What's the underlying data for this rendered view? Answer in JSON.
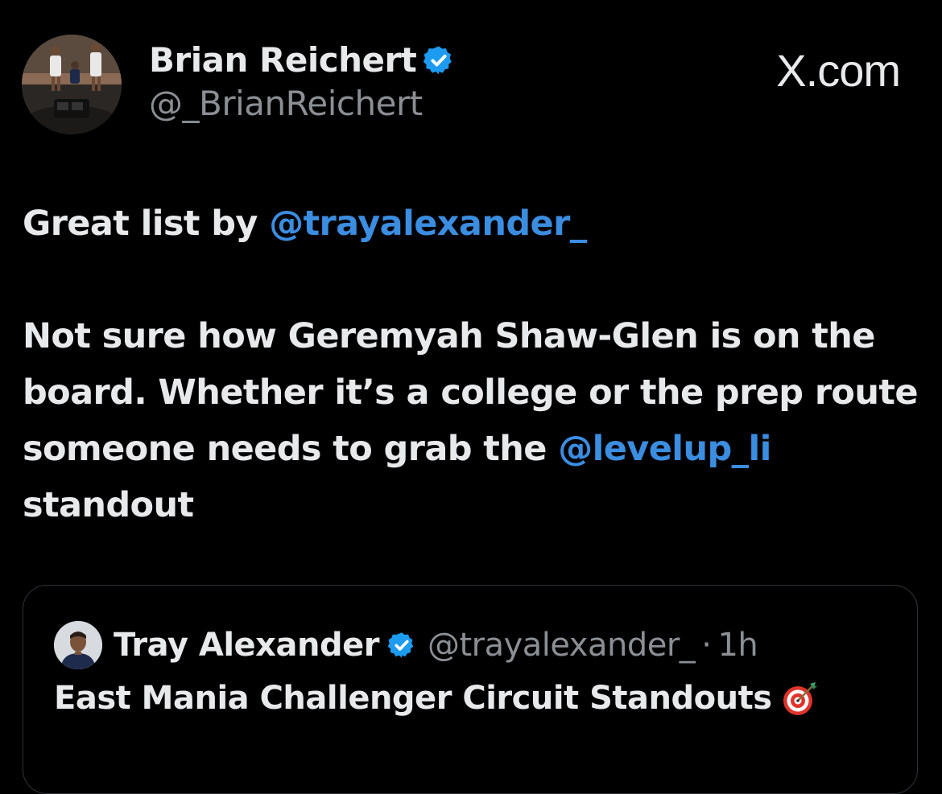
{
  "author": {
    "name": "Brian Reichert",
    "handle": "@_BrianReichert",
    "verified_badge_icon": "verified-badge-icon"
  },
  "site_label": "X.com",
  "tweet": {
    "line1_prefix": "Great list by ",
    "line1_mention": "@trayalexander_",
    "para2_text": "Not sure how Geremyah Shaw-Glen is on the board. Whether it’s a college or the prep route someone needs to grab the ",
    "para2_mention": "@levelup_li",
    "para2_suffix": " standout"
  },
  "quoted_tweet": {
    "name": "Tray Alexander",
    "handle": "@trayalexander_",
    "separator": "·",
    "time": "1h",
    "text": "East Mania Challenger Circuit Standouts",
    "emoji_icon": "direct-hit-target-icon"
  },
  "colors": {
    "background": "#000000",
    "text": "#e7e9ea",
    "secondary_text": "#8b8f94",
    "mention": "#3b8de0",
    "verified_badge": "#1d9bf0",
    "card_border": "#2f3336"
  }
}
